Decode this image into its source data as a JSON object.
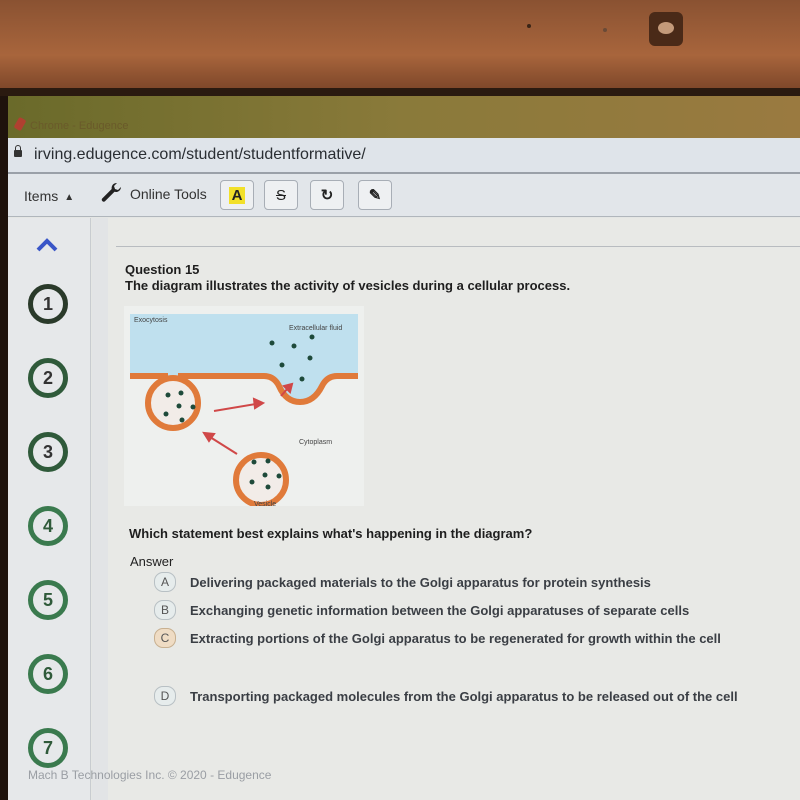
{
  "browser": {
    "tab_title": "Chrome - Edugence",
    "url": "irving.edugence.com/student/studentformative/"
  },
  "toolbar": {
    "items_label": "Items",
    "online_tools_label": "Online Tools",
    "highlight_label": "A",
    "strikethrough_label": "S",
    "undo_label": "↻",
    "pencil_label": "✎"
  },
  "sidebar": {
    "questions": [
      {
        "label": "1"
      },
      {
        "label": "2"
      },
      {
        "label": "3"
      },
      {
        "label": "4"
      },
      {
        "label": "5"
      },
      {
        "label": "6"
      },
      {
        "label": "7"
      }
    ]
  },
  "question": {
    "number_label": "Question 15",
    "stem": "The diagram illustrates the activity of vesicles during a cellular process.",
    "diagram": {
      "title": "Exocytosis",
      "label_top": "Extracellular fluid",
      "label_middle": "Cytoplasm",
      "label_bottom": "Vesicle",
      "colors": {
        "fluid": "#bfe0ee",
        "membrane": "#e07a3a",
        "molecule": "#1e4a3a",
        "arrow": "#d04848"
      }
    },
    "prompt": "Which statement best explains what's happening in the diagram?",
    "answer_label": "Answer",
    "choices": [
      {
        "letter": "A",
        "text": "Delivering packaged materials to the Golgi apparatus for protein synthesis"
      },
      {
        "letter": "B",
        "text": "Exchanging genetic information between the Golgi apparatuses of separate cells"
      },
      {
        "letter": "C",
        "text": "Extracting portions of the Golgi apparatus to be regenerated for growth within the cell"
      },
      {
        "letter": "D",
        "text": "Transporting packaged molecules from the Golgi apparatus to be released out of the cell"
      }
    ]
  },
  "footer": {
    "text": "Mach B Technologies Inc. © 2020 - Edugence"
  }
}
